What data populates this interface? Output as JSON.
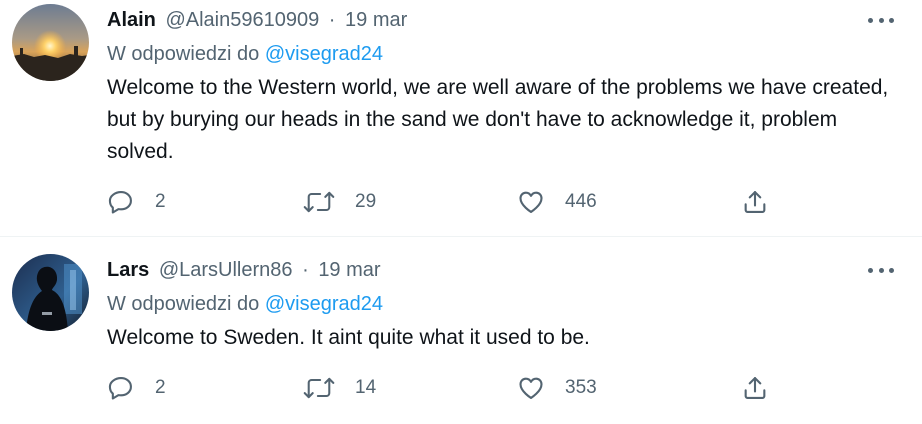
{
  "tweets": [
    {
      "name": "Alain",
      "handle": "@Alain59610909",
      "separator": "·",
      "date": "19 mar",
      "reply_prefix": "W odpowiedzi do",
      "reply_mention": "@visegrad24",
      "text": "Welcome to the Western world, we are well aware of the problems we have created, but by burying our heads in the sand we don't have to acknowledge it, problem solved.",
      "replies": "2",
      "retweets": "29",
      "likes": "446",
      "avatar_icon": "sunset-photo-avatar"
    },
    {
      "name": "Lars",
      "handle": "@LarsUllern86",
      "separator": "·",
      "date": "19 mar",
      "reply_prefix": "W odpowiedzi do",
      "reply_mention": "@visegrad24",
      "text": "Welcome to Sweden. It aint quite what it used to be.",
      "replies": "2",
      "retweets": "14",
      "likes": "353",
      "avatar_icon": "dark-figure-photo-avatar"
    }
  ],
  "icons": {
    "more": "more-dots-icon",
    "reply": "reply-bubble-icon",
    "retweet": "retweet-icon",
    "like": "heart-icon",
    "share": "share-upload-icon"
  },
  "colors": {
    "text": "#0f1419",
    "secondary": "#536471",
    "link": "#1d9bf0",
    "divider": "#eff3f4"
  }
}
